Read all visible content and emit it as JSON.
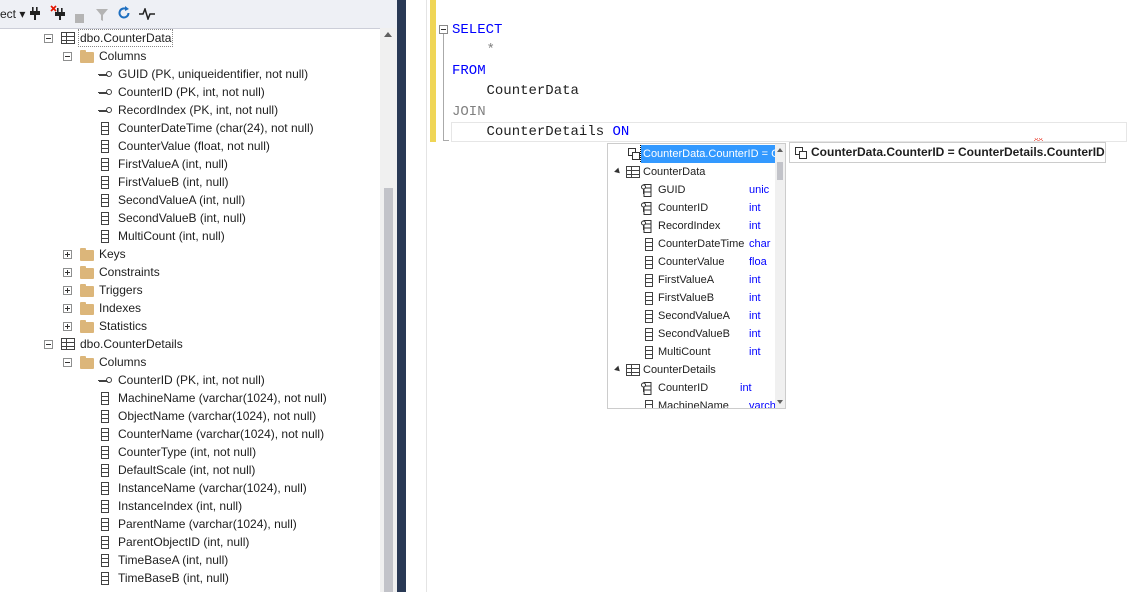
{
  "toolbar": {
    "connect_label": "ect ▾"
  },
  "tree": [
    {
      "kind": "table",
      "label": "dbo.CounterData",
      "level": 0,
      "expanded": true,
      "selected": true
    },
    {
      "kind": "folder",
      "label": "Columns",
      "level": 1,
      "expanded": true
    },
    {
      "kind": "key",
      "label": "GUID (PK, uniqueidentifier, not null)",
      "level": 2
    },
    {
      "kind": "key",
      "label": "CounterID (PK, int, not null)",
      "level": 2
    },
    {
      "kind": "key",
      "label": "RecordIndex (PK, int, not null)",
      "level": 2
    },
    {
      "kind": "column",
      "label": "CounterDateTime (char(24), not null)",
      "level": 2
    },
    {
      "kind": "column",
      "label": "CounterValue (float, not null)",
      "level": 2
    },
    {
      "kind": "column",
      "label": "FirstValueA (int, null)",
      "level": 2
    },
    {
      "kind": "column",
      "label": "FirstValueB (int, null)",
      "level": 2
    },
    {
      "kind": "column",
      "label": "SecondValueA (int, null)",
      "level": 2
    },
    {
      "kind": "column",
      "label": "SecondValueB (int, null)",
      "level": 2
    },
    {
      "kind": "column",
      "label": "MultiCount (int, null)",
      "level": 2
    },
    {
      "kind": "folder",
      "label": "Keys",
      "level": 1,
      "expanded": false
    },
    {
      "kind": "folder",
      "label": "Constraints",
      "level": 1,
      "expanded": false
    },
    {
      "kind": "folder",
      "label": "Triggers",
      "level": 1,
      "expanded": false
    },
    {
      "kind": "folder",
      "label": "Indexes",
      "level": 1,
      "expanded": false
    },
    {
      "kind": "folder",
      "label": "Statistics",
      "level": 1,
      "expanded": false
    },
    {
      "kind": "table",
      "label": "dbo.CounterDetails",
      "level": 0,
      "expanded": true
    },
    {
      "kind": "folder",
      "label": "Columns",
      "level": 1,
      "expanded": true
    },
    {
      "kind": "key",
      "label": "CounterID (PK, int, not null)",
      "level": 2
    },
    {
      "kind": "column",
      "label": "MachineName (varchar(1024), not null)",
      "level": 2
    },
    {
      "kind": "column",
      "label": "ObjectName (varchar(1024), not null)",
      "level": 2
    },
    {
      "kind": "column",
      "label": "CounterName (varchar(1024), not null)",
      "level": 2
    },
    {
      "kind": "column",
      "label": "CounterType (int, not null)",
      "level": 2
    },
    {
      "kind": "column",
      "label": "DefaultScale (int, not null)",
      "level": 2
    },
    {
      "kind": "column",
      "label": "InstanceName (varchar(1024), null)",
      "level": 2
    },
    {
      "kind": "column",
      "label": "InstanceIndex (int, null)",
      "level": 2
    },
    {
      "kind": "column",
      "label": "ParentName (varchar(1024), null)",
      "level": 2
    },
    {
      "kind": "column",
      "label": "ParentObjectID (int, null)",
      "level": 2
    },
    {
      "kind": "column",
      "label": "TimeBaseA (int, null)",
      "level": 2
    },
    {
      "kind": "column",
      "label": "TimeBaseB (int, null)",
      "level": 2
    }
  ],
  "editor": {
    "lines": [
      {
        "text": "SELECT",
        "cls": "kw",
        "indent": 0
      },
      {
        "text": "*",
        "cls": "gray",
        "indent": 3
      },
      {
        "text": "FROM",
        "cls": "kw",
        "indent": 0
      },
      {
        "text": "CounterData",
        "cls": "",
        "indent": 3
      },
      {
        "text": "JOIN",
        "cls": "gray",
        "indent": 0
      },
      {
        "text": "CounterDetails",
        "cls": "",
        "indent": 3,
        "suffix": "ON",
        "suffix_cls": "kw"
      }
    ]
  },
  "intellisense": {
    "items": [
      {
        "kind": "rel",
        "label": "CounterData.CounterID = CounterDetails.CounterID",
        "type": "",
        "level": 1,
        "selected": true
      },
      {
        "kind": "table",
        "label": "CounterData",
        "type": "",
        "level": 0,
        "group": true
      },
      {
        "kind": "key",
        "label": "GUID",
        "type": "unic",
        "level": 1
      },
      {
        "kind": "key",
        "label": "CounterID",
        "type": "int",
        "level": 1
      },
      {
        "kind": "key",
        "label": "RecordIndex",
        "type": "int",
        "level": 1
      },
      {
        "kind": "column",
        "label": "CounterDateTime",
        "type": "char",
        "level": 1
      },
      {
        "kind": "column",
        "label": "CounterValue",
        "type": "floa",
        "level": 1
      },
      {
        "kind": "column",
        "label": "FirstValueA",
        "type": "int",
        "level": 1
      },
      {
        "kind": "column",
        "label": "FirstValueB",
        "type": "int",
        "level": 1
      },
      {
        "kind": "column",
        "label": "SecondValueA",
        "type": "int",
        "level": 1
      },
      {
        "kind": "column",
        "label": "SecondValueB",
        "type": "int",
        "level": 1
      },
      {
        "kind": "column",
        "label": "MultiCount",
        "type": "int",
        "level": 1
      },
      {
        "kind": "table",
        "label": "CounterDetails",
        "type": "",
        "level": 0,
        "group": true
      },
      {
        "kind": "key",
        "label": "CounterID",
        "type": "int",
        "level": 1
      },
      {
        "kind": "column",
        "label": "MachineName",
        "type": "varch",
        "level": 1
      }
    ]
  },
  "tooltip": {
    "text": "CounterData.CounterID = CounterDetails.CounterID"
  },
  "colors": {
    "keyword": "#0000ff",
    "selection": "#3399ff",
    "splitter": "#293955",
    "change_margin": "#efd556"
  }
}
